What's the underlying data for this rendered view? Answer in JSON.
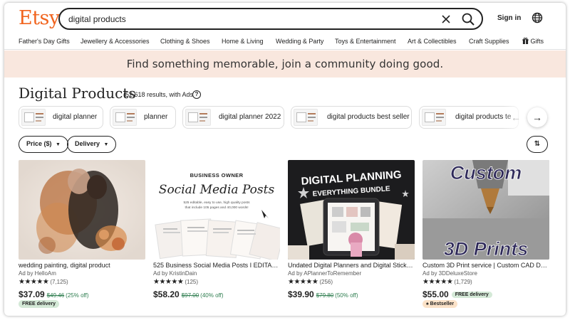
{
  "header": {
    "logo": "Etsy",
    "search_value": "digital products",
    "sign_in": "Sign in"
  },
  "categories": [
    "Father's Day Gifts",
    "Jewellery & Accessories",
    "Clothing & Shoes",
    "Home & Living",
    "Wedding & Party",
    "Toys & Entertainment",
    "Art & Collectibles",
    "Craft Supplies",
    "Gifts"
  ],
  "banner": "Find something memorable, join a community doing good.",
  "results": {
    "title": "Digital Products",
    "count": "(52,618 results, with Ads",
    "help": "?"
  },
  "chips": [
    "digital planner",
    "planner",
    "digital planner 2022",
    "digital products best seller",
    "digital products te"
  ],
  "filters": {
    "price": "Price ($)",
    "delivery": "Delivery"
  },
  "listings": [
    {
      "title": "wedding painting, digital product",
      "ad": "Ad by HelloAm",
      "stars": "★★★★★",
      "reviews": "(7,125)",
      "price": "$37.09",
      "original_price": "$49.46",
      "discount": "(25% off)",
      "badge": "FREE delivery",
      "image_text": []
    },
    {
      "title": "525 Business Social Media Posts I EDITABL...",
      "ad": "Ad by KristinDain",
      "stars": "★★★★★",
      "reviews": "(125)",
      "price": "$58.20",
      "original_price": "$97.00",
      "discount": "(40% off)",
      "image_text": [
        "BUSINESS OWNER",
        "Social Media Posts",
        "525 editable, easy to use, high quality posts",
        "that include 105 pages and 40,000 words!"
      ]
    },
    {
      "title": "Undated Digital Planners and Digital Sticke...",
      "ad": "Ad by APlannerToRemember",
      "stars": "★★★★★",
      "reviews": "(256)",
      "price": "$39.90",
      "original_price": "$79.80",
      "discount": "(50% off)",
      "image_text": [
        "DIGITAL PLANNING",
        "EVERYTHING BUNDLE"
      ]
    },
    {
      "title": "Custom 3D Print service | Custom CAD Des...",
      "ad": "Ad by 3DDeluxeStore",
      "stars": "★★★★★",
      "reviews": "(1,729)",
      "price": "$55.00",
      "inline_badge": "FREE delivery",
      "badge": "Bestseller",
      "image_text": [
        "Custom",
        "3D Prints"
      ]
    }
  ],
  "colors": {
    "brand": "#F1641E",
    "banner_bg": "#F9E7DE",
    "discount_green": "#2E7D4F",
    "free_delivery_bg": "#D4E9D7",
    "bestseller_bg": "#FBE2C8"
  },
  "icons": {
    "search": "search-icon",
    "clear": "close-icon",
    "globe": "globe-icon",
    "gift": "gift-icon",
    "prev": "arrow-left-icon",
    "next": "arrow-right-icon",
    "sort": "sort-icon"
  }
}
